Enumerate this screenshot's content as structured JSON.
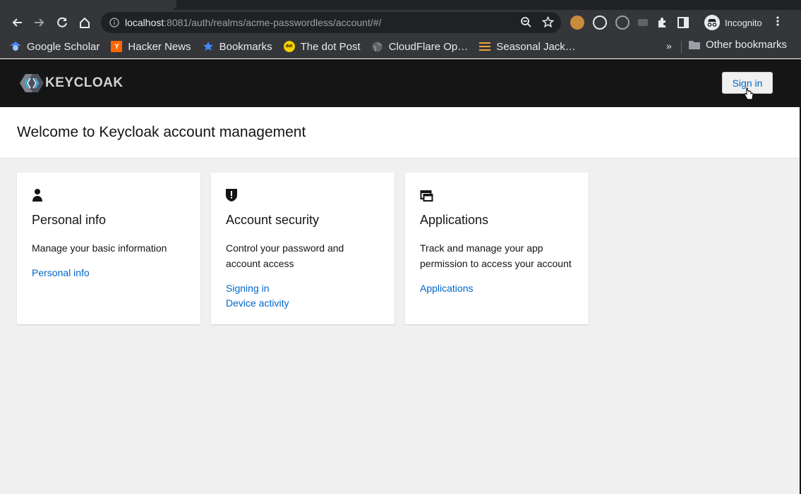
{
  "browser": {
    "url_host": "localhost",
    "url_rest": ":8081/auth/realms/acme-passwordless/account/#/",
    "profile_label": "Incognito",
    "bookmarks": [
      {
        "label": "Google Scholar",
        "icon": "scholar-icon"
      },
      {
        "label": "Hacker News",
        "icon": "hacker-news-icon"
      },
      {
        "label": "Bookmarks",
        "icon": "star-icon"
      },
      {
        "label": "The dot Post",
        "icon": "dot-post-icon"
      },
      {
        "label": "CloudFlare Op…",
        "icon": "globe-icon"
      },
      {
        "label": "Seasonal Jack…",
        "icon": "list-icon"
      }
    ],
    "more_bookmarks": "»",
    "other_bookmarks": "Other bookmarks",
    "hn_letter": "Y",
    "dot_letter": "dot"
  },
  "header": {
    "logo_text": "KEYCLOAK",
    "signin_label": "Sign in"
  },
  "welcome": {
    "title": "Welcome to Keycloak account management"
  },
  "cards": [
    {
      "title": "Personal info",
      "description": "Manage your basic information",
      "links": [
        "Personal info"
      ]
    },
    {
      "title": "Account security",
      "description": "Control your password and account access",
      "links": [
        "Signing in",
        "Device activity"
      ]
    },
    {
      "title": "Applications",
      "description": "Track and manage your app permission to access your account",
      "links": [
        "Applications"
      ]
    }
  ],
  "colors": {
    "link": "#0066cc",
    "header_bg": "#151515",
    "page_bg": "#f0f0f0"
  }
}
